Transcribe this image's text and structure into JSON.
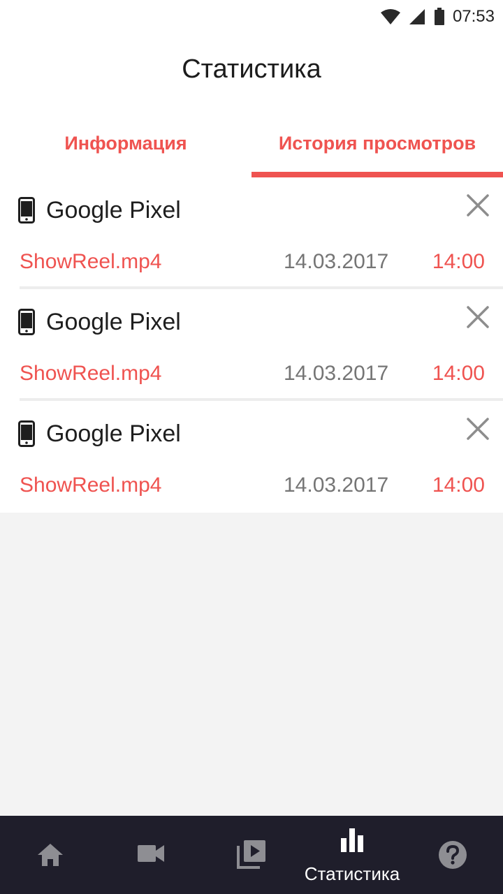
{
  "status_bar": {
    "time": "07:53",
    "icons": [
      "wifi-icon",
      "signal-icon",
      "battery-icon"
    ]
  },
  "header": {
    "title": "Статистика"
  },
  "tabs": [
    {
      "label": "Информация",
      "active": false
    },
    {
      "label": "История просмотров",
      "active": true
    }
  ],
  "history": [
    {
      "device": "Google Pixel",
      "file": "ShowReel.mp4",
      "date": "14.03.2017",
      "time": "14:00"
    },
    {
      "device": "Google Pixel",
      "file": "ShowReel.mp4",
      "date": "14.03.2017",
      "time": "14:00"
    },
    {
      "device": "Google Pixel",
      "file": "ShowReel.mp4",
      "date": "14.03.2017",
      "time": "14:00"
    }
  ],
  "bottom_nav": [
    {
      "icon": "home-icon"
    },
    {
      "icon": "videocam-icon"
    },
    {
      "icon": "video-library-icon"
    },
    {
      "icon": "bar-chart-icon",
      "label": "Статистика",
      "active": true
    },
    {
      "icon": "help-icon"
    }
  ],
  "colors": {
    "accent": "#ef5350",
    "nav_background": "#1f1e2b",
    "nav_inactive_icon": "#8e8e93",
    "nav_active": "#ffffff"
  }
}
